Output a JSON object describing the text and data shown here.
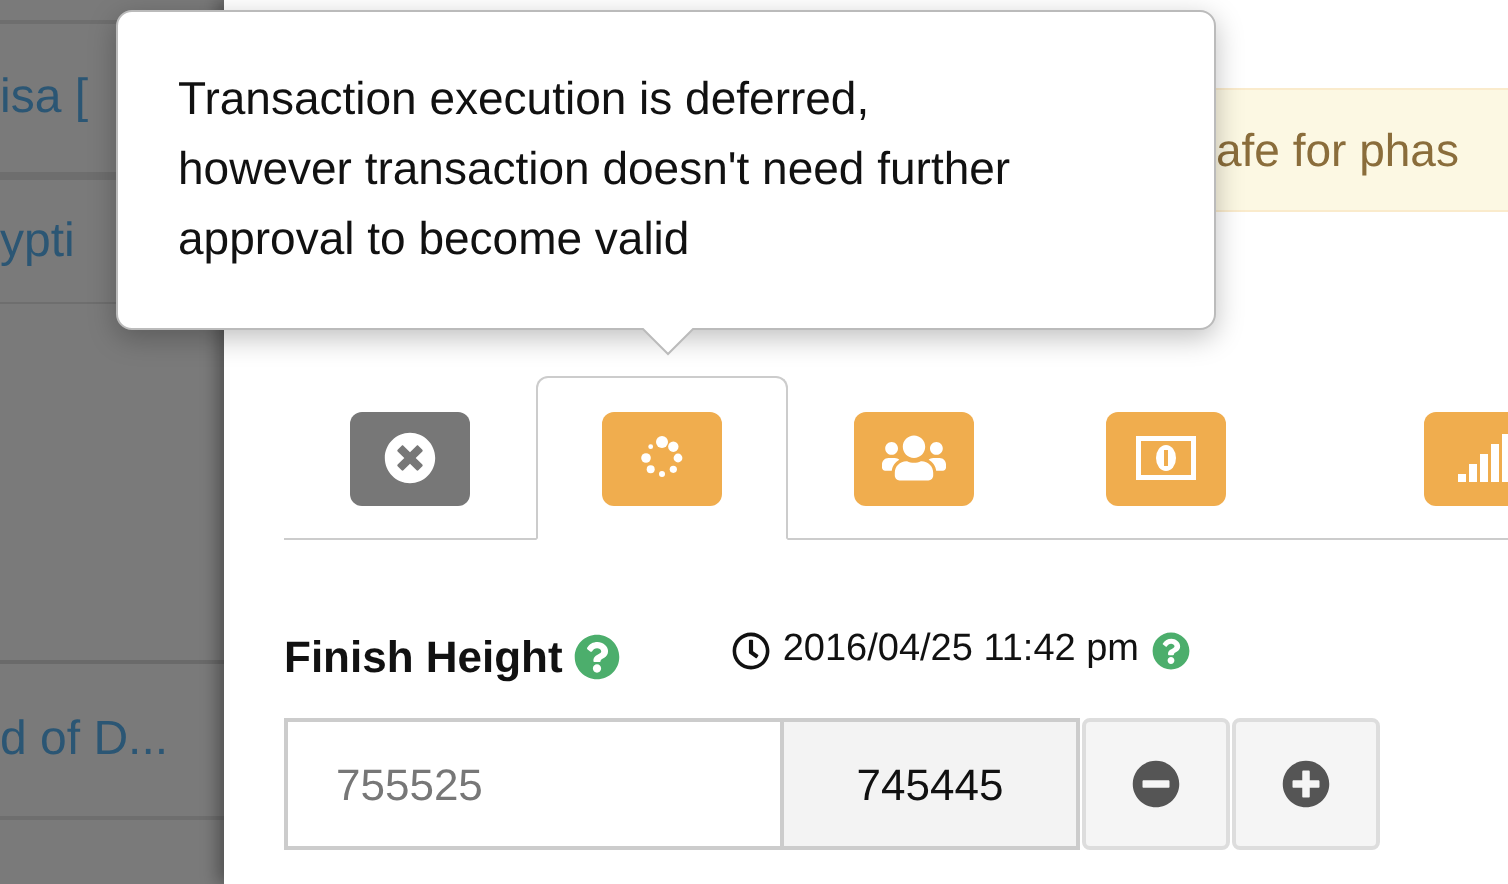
{
  "sidebar": {
    "items": [
      {
        "label": "isa ["
      },
      {
        "label": "ypti"
      },
      {
        "label": "d of D..."
      }
    ]
  },
  "warning": {
    "text": "afe for phas"
  },
  "tooltip": {
    "text": "Transaction execution is deferred, however transaction doesn't need further approval to become valid"
  },
  "tabs": [
    {
      "kind": "cancel",
      "color": "#777777",
      "selected": false
    },
    {
      "kind": "spinner",
      "color": "#f0ad4e",
      "selected": true
    },
    {
      "kind": "users",
      "color": "#f0ad4e",
      "selected": false
    },
    {
      "kind": "money",
      "color": "#f0ad4e",
      "selected": false
    },
    {
      "kind": "signal",
      "color": "#f0ad4e",
      "selected": false
    }
  ],
  "finish_height": {
    "label": "Finish Height",
    "date": "2016/04/25 11:42 pm",
    "input": {
      "placeholder": "755525"
    },
    "current": "745445",
    "buttons": [
      {
        "kind": "minus"
      },
      {
        "kind": "plus"
      }
    ]
  }
}
